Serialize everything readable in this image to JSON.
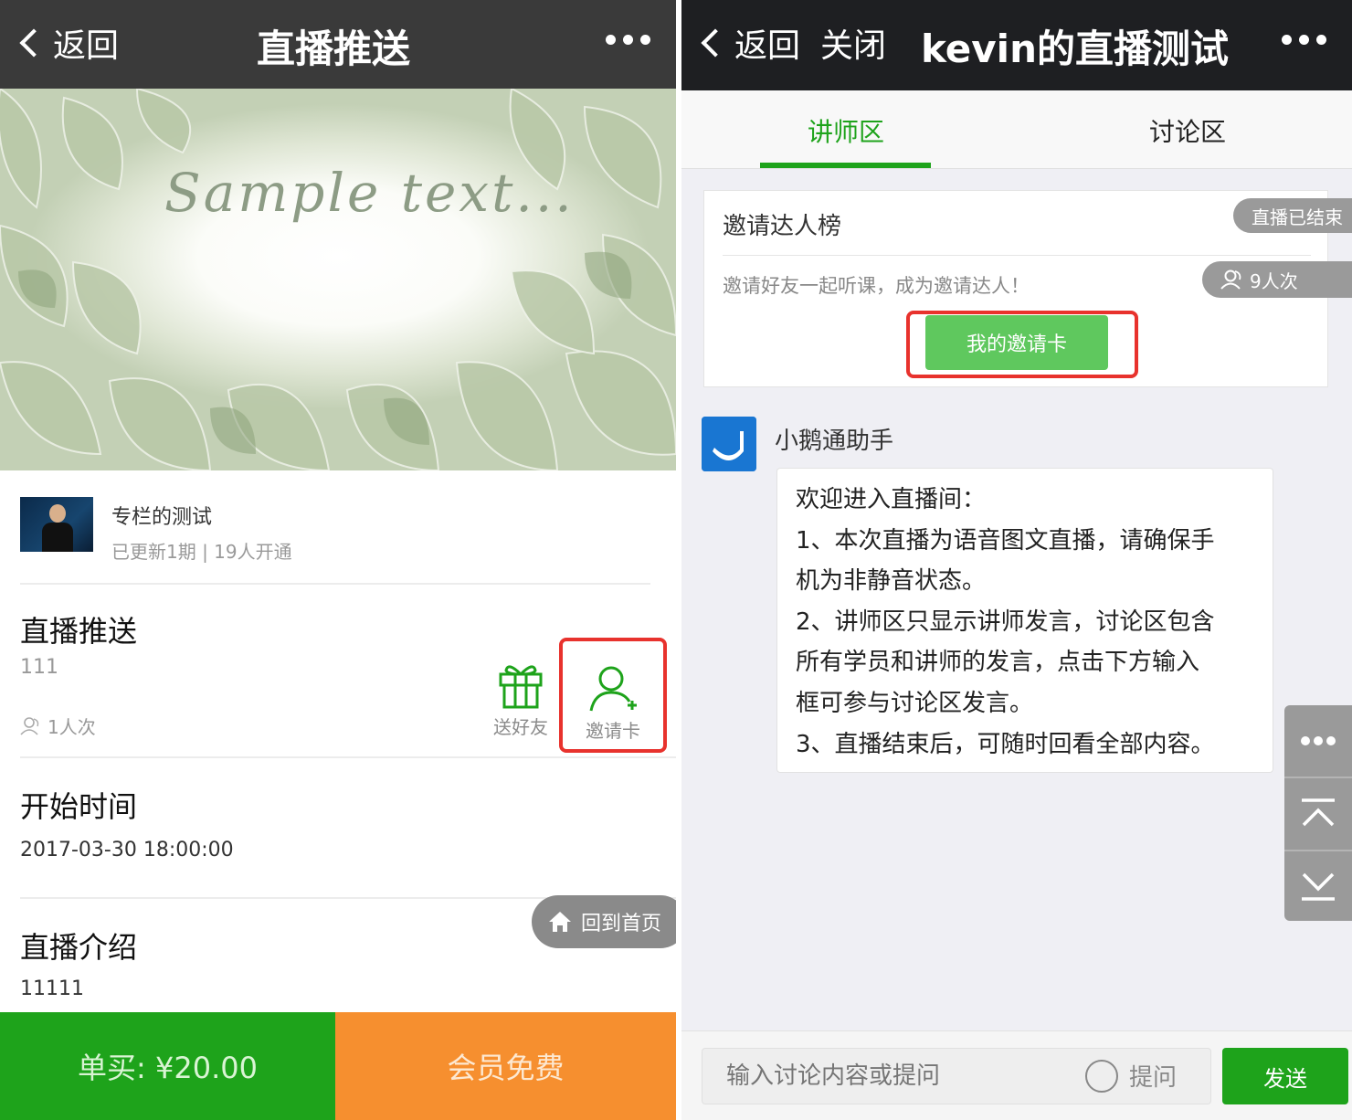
{
  "left": {
    "navbar": {
      "back_label": "返回",
      "title": "直播推送"
    },
    "banner": {
      "text": "Sample text..."
    },
    "column": {
      "title": "专栏的测试",
      "meta": "已更新1期 | 19人开通"
    },
    "live": {
      "title": "直播推送",
      "description": "111",
      "views": "1人次"
    },
    "actions": {
      "gift_label": "送好友",
      "invite_label": "邀请卡"
    },
    "start": {
      "heading": "开始时间",
      "value": "2017-03-30 18:00:00"
    },
    "intro": {
      "heading": "直播介绍",
      "value": "11111"
    },
    "home_button": "回到首页",
    "buy": {
      "single": "单买: ¥20.00",
      "member": "会员免费"
    },
    "colors": {
      "green": "#1ea31b",
      "orange": "#f68f2f",
      "highlight": "#e8322d"
    }
  },
  "right": {
    "navbar": {
      "back_label": "返回",
      "close_label": "关闭",
      "title": "kevin的直播测试"
    },
    "tabs": [
      {
        "label": "讲师区",
        "active": true
      },
      {
        "label": "讨论区",
        "active": false
      }
    ],
    "invite_card": {
      "title": "邀请达人榜",
      "description": "邀请好友一起听课，成为邀请达人！",
      "button": "我的邀请卡",
      "status_badge": "直播已结束",
      "views": "9人次"
    },
    "message": {
      "sender": "小鹅通助手",
      "lines": [
        "欢迎进入直播间：",
        "1、本次直播为语音图文直播，请确保手",
        "机为非静音状态。",
        "2、讲师区只显示讲师发言，讨论区包含",
        "所有学员和讲师的发言，点击下方输入",
        "框可参与讨论区发言。",
        "3、直播结束后，可随时回看全部内容。"
      ]
    },
    "input": {
      "placeholder": "输入讨论内容或提问",
      "ask_label": "提问",
      "send_label": "发送"
    }
  },
  "icons": {
    "back": "chevron-left-icon",
    "more": "more-dots-icon",
    "gift": "gift-icon",
    "invite": "add-user-icon",
    "home": "home-icon",
    "views": "people-icon",
    "scroll_top": "scroll-top-icon",
    "scroll_bottom": "scroll-bottom-icon"
  }
}
